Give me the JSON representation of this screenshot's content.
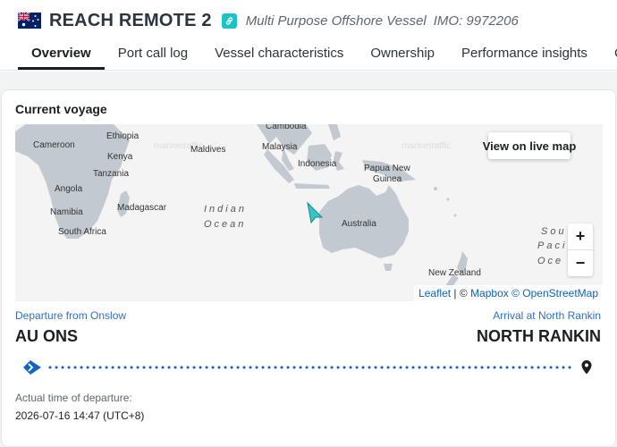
{
  "vessel": {
    "name": "REACH REMOTE 2",
    "type": "Multi Purpose Offshore Vessel",
    "imo": "IMO: 9972206",
    "flag_icon": "australia-flag-icon",
    "link_icon": "link-icon"
  },
  "tabs": [
    {
      "label": "Overview",
      "active": true
    },
    {
      "label": "Port call log",
      "active": false
    },
    {
      "label": "Vessel characteristics",
      "active": false
    },
    {
      "label": "Ownership",
      "active": false
    },
    {
      "label": "Performance insights",
      "active": false
    },
    {
      "label": "Com",
      "active": false
    }
  ],
  "voyage": {
    "title": "Current voyage",
    "departure_label": "Departure from Onslow",
    "departure_port": "AU ONS",
    "arrival_label": "Arrival at North Rankin",
    "arrival_port": "NORTH RANKIN",
    "atd_label": "Actual time of departure:",
    "atd_value": "2026-07-16 14:47 (UTC+8)"
  },
  "map": {
    "view_live_label": "View on live map",
    "zoom_in": "+",
    "zoom_out": "−",
    "attribution_leaflet": "Leaflet",
    "attribution_sep": " | © ",
    "attribution_mapbox": "Mapbox",
    "attribution_osm": "© OpenStreetMap",
    "watermark": "marinetraffic",
    "labels": {
      "cambodia": "Cambodia",
      "cameroon": "Cameroon",
      "ethiopia": "Ethiopia",
      "maldives": "Maldives",
      "malaysia": "Malaysia",
      "kenya": "Kenya",
      "indonesia": "Indonesia",
      "tanzania": "Tanzania",
      "papua": "Papua New",
      "guinea": "Guinea",
      "angola": "Angola",
      "madagascar": "Madagascar",
      "namibia": "Namibia",
      "south_africa": "South Africa",
      "indian": "Indian",
      "ocean": "Ocean",
      "australia": "Australia",
      "new_zealand": "New Zealand",
      "sou": "Sou",
      "paci": "Paci",
      "oce": "Oce"
    },
    "colors": {
      "land": "#c3c9d0",
      "water": "#f4f4f4",
      "vessel": "#36c6c8"
    }
  },
  "colors": {
    "accent_blue": "#2f6fbf",
    "progress_blue": "#1565c0"
  }
}
